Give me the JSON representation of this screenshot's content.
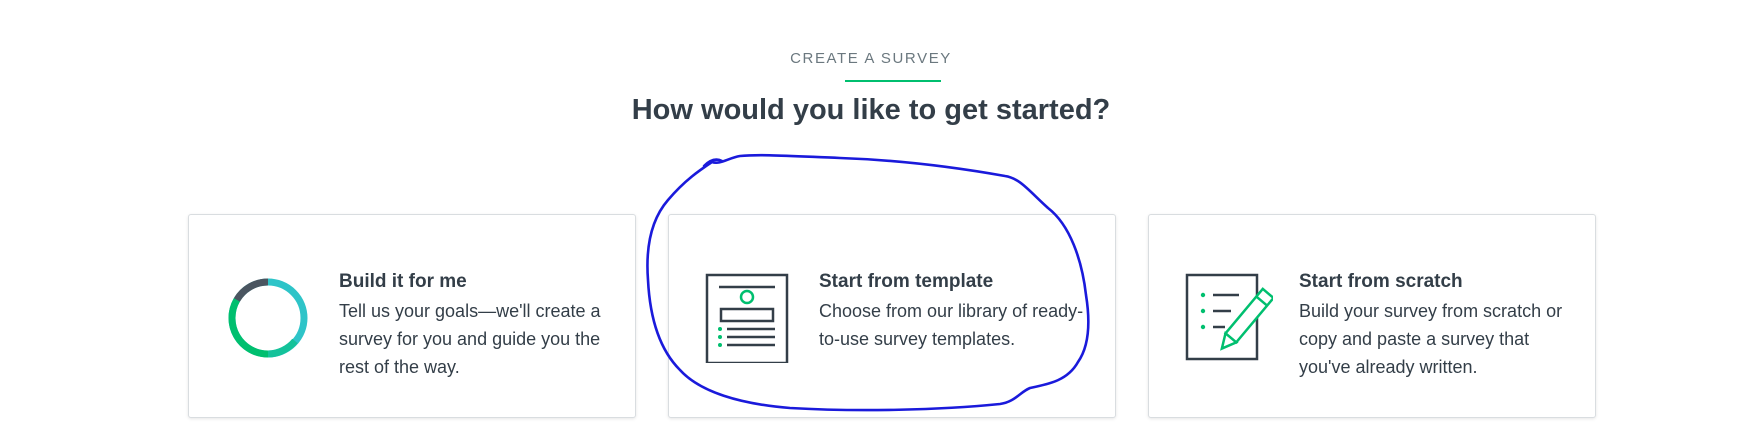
{
  "header": {
    "eyebrow": "CREATE A SURVEY",
    "title": "How would you like to get started?"
  },
  "cards": [
    {
      "title": "Build it for me",
      "description": "Tell us your goals—we'll create a survey for you and guide you the rest of the way.",
      "icon": "progress-ring-icon"
    },
    {
      "title": "Start from template",
      "description": "Choose from our library of ready-to-use survey templates.",
      "icon": "template-document-icon"
    },
    {
      "title": "Start from scratch",
      "description": "Build your survey from scratch or copy and paste a survey that you've already written.",
      "icon": "document-pencil-icon"
    }
  ],
  "colors": {
    "accent": "#00bf6f",
    "ring_teal": "#2ec4c8",
    "heading": "#333e48",
    "muted": "#6b787f",
    "annotation": "#1a1adb"
  }
}
